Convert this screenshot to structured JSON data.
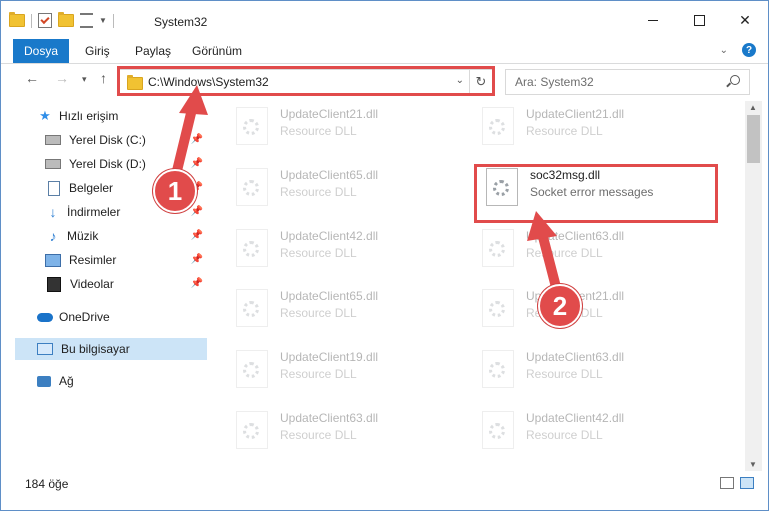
{
  "window": {
    "title": "System32",
    "minimize_icon": "minimize-icon",
    "maximize_icon": "maximize-icon",
    "close_label": "✕"
  },
  "ribbon": {
    "tabs": [
      {
        "label": "Dosya"
      },
      {
        "label": "Giriş"
      },
      {
        "label": "Paylaş"
      },
      {
        "label": "Görünüm"
      }
    ],
    "help_label": "?"
  },
  "address": {
    "path": "C:\\Windows\\System32",
    "search_placeholder": "Ara: System32"
  },
  "sidebar": {
    "items": [
      {
        "label": "Hızlı erişim"
      },
      {
        "label": "Yerel Disk (C:)"
      },
      {
        "label": "Yerel Disk (D:)"
      },
      {
        "label": "Belgeler"
      },
      {
        "label": "İndirmeler"
      },
      {
        "label": "Müzik"
      },
      {
        "label": "Resimler"
      },
      {
        "label": "Videolar"
      },
      {
        "label": "OneDrive"
      },
      {
        "label": "Bu bilgisayar"
      },
      {
        "label": "Ağ"
      }
    ]
  },
  "files": [
    {
      "name": "UpdateClient21.dll",
      "desc": "Resource DLL"
    },
    {
      "name": "UpdateClient21.dll",
      "desc": "Resource DLL"
    },
    {
      "name": "UpdateClient65.dll",
      "desc": "Resource DLL"
    },
    {
      "name": "soc32msg.dll",
      "desc": "Socket error messages"
    },
    {
      "name": "UpdateClient42.dll",
      "desc": "Resource DLL"
    },
    {
      "name": "UpdateClient63.dll",
      "desc": "Resource DLL"
    },
    {
      "name": "UpdateClient65.dll",
      "desc": "Resource DLL"
    },
    {
      "name": "UpdateClient21.dll",
      "desc": "Resource DLL"
    },
    {
      "name": "UpdateClient19.dll",
      "desc": "Resource DLL"
    },
    {
      "name": "UpdateClient63.dll",
      "desc": "Resource DLL"
    },
    {
      "name": "UpdateClient63.dll",
      "desc": "Resource DLL"
    },
    {
      "name": "UpdateClient42.dll",
      "desc": "Resource DLL"
    }
  ],
  "status": {
    "item_count": "184 öğe"
  },
  "annotations": {
    "callout_1": "1",
    "callout_2": "2",
    "highlight_color": "#e14b4b"
  }
}
